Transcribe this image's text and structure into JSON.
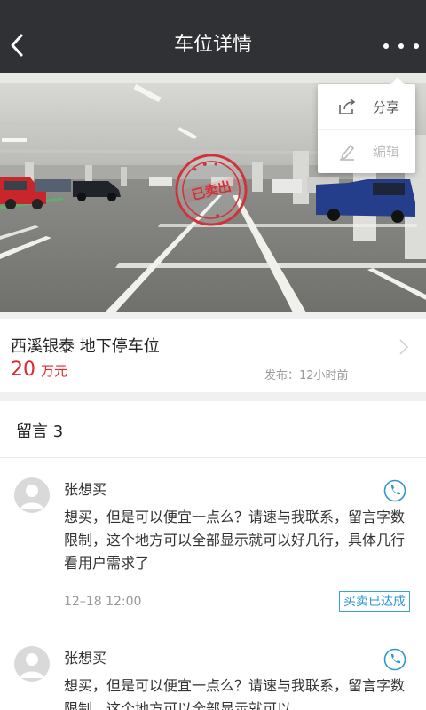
{
  "nav": {
    "title": "车位详情"
  },
  "popup": {
    "share_label": "分享",
    "edit_label": "编辑"
  },
  "stamp": {
    "text": "已卖出"
  },
  "listing": {
    "name": "西溪银泰 地下停车位",
    "price_value": "20",
    "price_unit": "万元",
    "published": "发布：12小时前"
  },
  "comments": {
    "header": "留言 3",
    "items": [
      {
        "user": "张想买",
        "text": "想买，但是可以便宜一点么？请速与我联系，留言字数限制，这个地方可以全部显示就可以好几行，具体几行看用户需求了",
        "time": "12–18  12:00",
        "badge": "买卖已达成"
      },
      {
        "user": "张想买",
        "text": "想买，但是可以便宜一点么？请速与我联系，留言字数限制，这个地方可以全部显示就可以"
      }
    ]
  },
  "colors": {
    "nav_bg": "#2f3134",
    "price": "#e0262e",
    "accent": "#2e97d1",
    "stamp": "#d0323a"
  },
  "icons": [
    "back-arrow-icon",
    "more-dots-icon",
    "share-icon",
    "edit-icon",
    "chevron-right-icon",
    "phone-icon",
    "avatar-icon"
  ]
}
